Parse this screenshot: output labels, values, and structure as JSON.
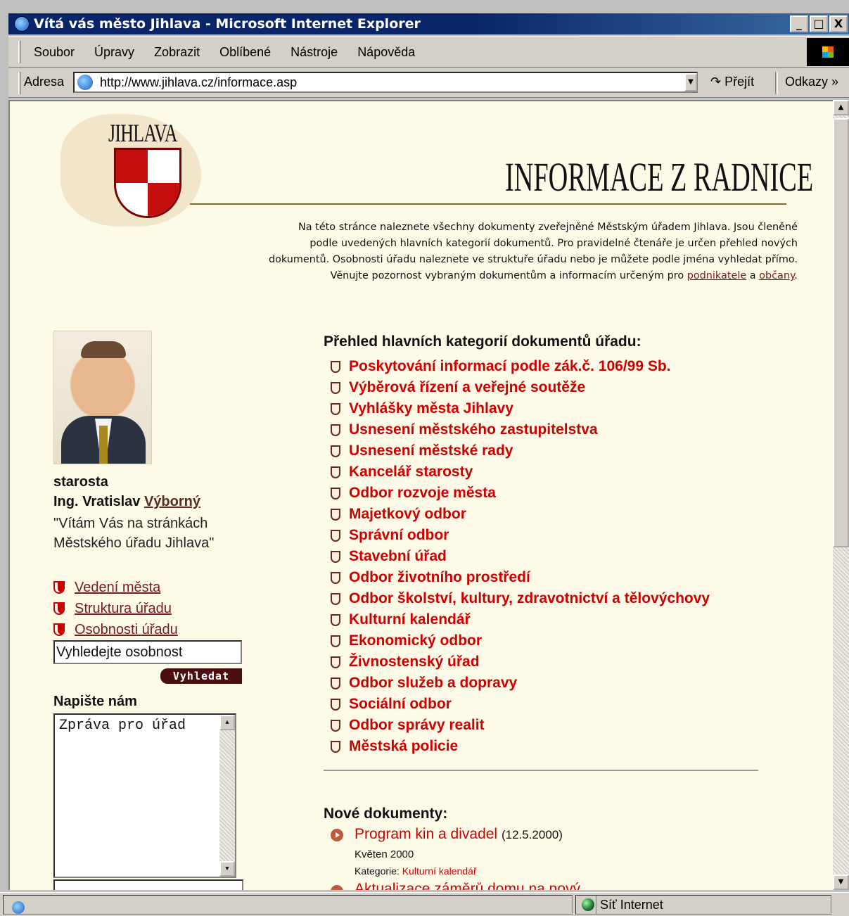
{
  "window": {
    "title": "Vítá vás město Jihlava - Microsoft Internet Explorer",
    "buttons": [
      "_",
      "□",
      "X"
    ]
  },
  "menu": [
    "Soubor",
    "Úpravy",
    "Zobrazit",
    "Oblíbené",
    "Nástroje",
    "Nápověda"
  ],
  "address": {
    "label": "Adresa",
    "url": "http://www.jihlava.cz/informace.asp",
    "go_label": "Přejít",
    "links_label": "Odkazy"
  },
  "page": {
    "city_name": "JIHLAVA",
    "heading": "INFORMACE Z RADNICE",
    "intro_lines": [
      "Na této stránce naleznete všechny dokumenty zveřejněné Městským úřadem Jihlava. Jsou členěné",
      "podle uvedených hlavních kategorií dokumentů. Pro pravidelné čtenáře je určen přehled nových",
      "dokumentů. Osobnosti úřadu naleznete ve struktuře úřadu nebo je můžete podle jména vyhledat přímo."
    ],
    "intro_last_prefix": "Věnujte pozornost vybraným dokumentům a informacím určeným pro ",
    "intro_link_business": "podnikatele",
    "intro_and": " a ",
    "intro_link_citizens": "občany",
    "intro_end": ".",
    "mayor": {
      "role": "starosta",
      "name_prefix": "Ing. Vratislav ",
      "name_link": "Výborný",
      "quote_line1": "\"Vítám Vás na stránkách",
      "quote_line2": "Městského úřadu Jihlava\""
    },
    "side_links": [
      "Vedení města",
      "Struktura úřadu",
      "Osobnosti úřadu"
    ],
    "search": {
      "value": "Vyhledejte osobnost",
      "button": "Vyhledat"
    },
    "write": {
      "title": "Napište nám",
      "message_value": "Zpráva pro úřad"
    },
    "categories_title": "Přehled hlavních kategorií dokumentů úřadu:",
    "categories": [
      "Poskytování informací podle zák.č. 106/99 Sb.",
      "Výběrová řízení a veřejné soutěže",
      "Vyhlášky města Jihlavy",
      "Usnesení městského zastupitelstva",
      "Usnesení městské rady",
      "Kancelář starosty",
      "Odbor rozvoje města",
      "Majetkový odbor",
      "Správní odbor",
      "Stavební úřad",
      "Odbor životního prostředí",
      "Odbor školství, kultury, zdravotnictví a tělovýchovy",
      "Kulturní kalendář",
      "Ekonomický odbor",
      "Živnostenský úřad",
      "Odbor služeb a dopravy",
      "Sociální odbor",
      "Odbor správy realit",
      "Městská policie"
    ],
    "new_docs_title": "Nové dokumenty:",
    "new_docs": [
      {
        "title": "Program kin a divadel",
        "date": "(12.5.2000)",
        "month": "Květen 2000",
        "category_label": "Kategorie: ",
        "category": "Kulturní kalendář"
      }
    ],
    "cut_doc_title": "Aktualizace záměrů domu na nový"
  },
  "status": {
    "zone": "Síť Internet"
  },
  "colors": {
    "page_bg": "#fdfbe8",
    "link_red": "#cc0000",
    "title_bar": "#0a246a"
  }
}
